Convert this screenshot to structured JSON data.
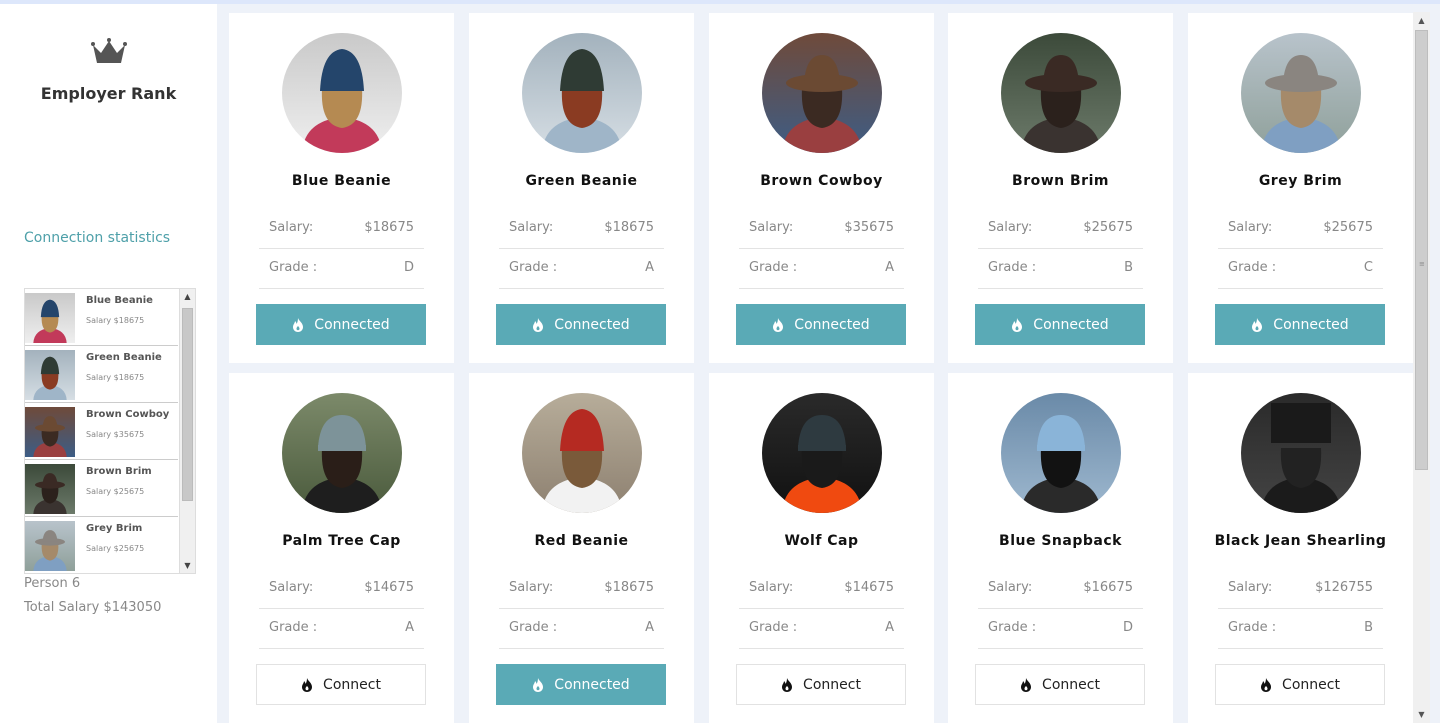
{
  "sidebar": {
    "brand": "Employer Rank",
    "stats_title": "Connection statistics",
    "connections": [
      {
        "name": "Blue Beanie",
        "salary": "Salary $18675",
        "photo": "blue-beanie"
      },
      {
        "name": "Green Beanie",
        "salary": "Salary $18675",
        "photo": "green-beanie"
      },
      {
        "name": "Brown Cowboy",
        "salary": "Salary $35675",
        "photo": "brown-cowboy"
      },
      {
        "name": "Brown Brim",
        "salary": "Salary $25675",
        "photo": "brown-brim"
      },
      {
        "name": "Grey Brim",
        "salary": "Salary $25675",
        "photo": "grey-brim"
      }
    ],
    "person_count": "Person 6",
    "total_salary": "Total Salary $143050"
  },
  "labels": {
    "salary": "Salary:",
    "grade": "Grade :"
  },
  "employees": [
    {
      "name": "Blue Beanie",
      "salary": "$18675",
      "grade": "D",
      "button": "Connected",
      "state": "connected",
      "photo": "blue-beanie"
    },
    {
      "name": "Green Beanie",
      "salary": "$18675",
      "grade": "A",
      "button": "Connected",
      "state": "connected",
      "photo": "green-beanie"
    },
    {
      "name": "Brown Cowboy",
      "salary": "$35675",
      "grade": "A",
      "button": "Connected",
      "state": "connected",
      "photo": "brown-cowboy"
    },
    {
      "name": "Brown Brim",
      "salary": "$25675",
      "grade": "B",
      "button": "Connected",
      "state": "connected",
      "photo": "brown-brim"
    },
    {
      "name": "Grey Brim",
      "salary": "$25675",
      "grade": "C",
      "button": "Connected",
      "state": "connected",
      "photo": "grey-brim"
    },
    {
      "name": "Palm Tree Cap",
      "salary": "$14675",
      "grade": "A",
      "button": "Connect",
      "state": "connect",
      "photo": "palm-tree-cap"
    },
    {
      "name": "Red Beanie",
      "salary": "$18675",
      "grade": "A",
      "button": "Connected",
      "state": "connected",
      "photo": "red-beanie"
    },
    {
      "name": "Wolf Cap",
      "salary": "$14675",
      "grade": "A",
      "button": "Connect",
      "state": "connect",
      "photo": "wolf-cap"
    },
    {
      "name": "Blue Snapback",
      "salary": "$16675",
      "grade": "D",
      "button": "Connect",
      "state": "connect",
      "photo": "blue-snapback"
    },
    {
      "name": "Black Jean Shearling",
      "salary": "$126755",
      "grade": "B",
      "button": "Connect",
      "state": "connect",
      "photo": "black-jean-shearling"
    }
  ],
  "colors": {
    "accent": "#5aaab6",
    "stats_title": "#4ea0a9",
    "page_bg": "#eef2f9"
  }
}
